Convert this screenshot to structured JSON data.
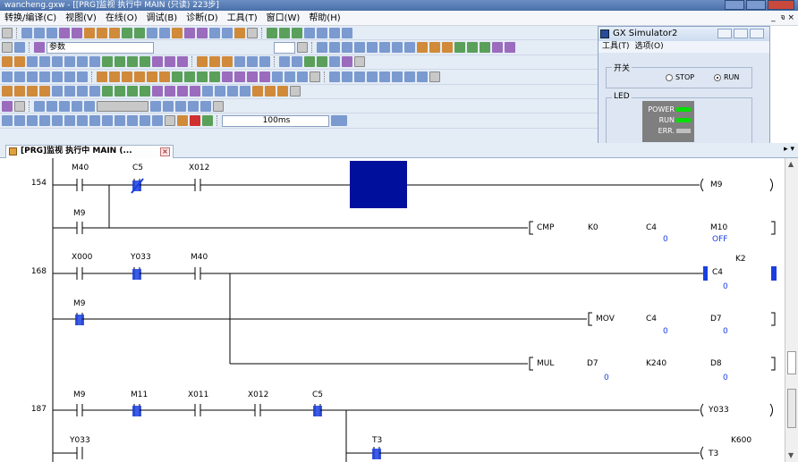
{
  "window": {
    "title": " wancheng.gxw - [[PRG]监视 执行中 MAIN (只读) 223步]",
    "mdi_controls": "_  จ ×"
  },
  "menu": {
    "items": [
      "转换/编译(C)",
      "视图(V)",
      "在线(O)",
      "调试(B)",
      "诊断(D)",
      "工具(T)",
      "窗口(W)",
      "帮助(H)"
    ]
  },
  "toolbar": {
    "param_label": "参数",
    "scan_time": "100ms"
  },
  "simulator": {
    "title": "GX Simulator2",
    "menu": [
      "工具(T)",
      "选项(O)"
    ],
    "switch_group": "开关",
    "stop_label": "STOP",
    "run_label": "RUN",
    "mode": "RUN",
    "led_group": "LED",
    "leds": [
      {
        "label": "POWER",
        "color": "#00e000"
      },
      {
        "label": "RUN",
        "color": "#00e000"
      },
      {
        "label": "ERR.",
        "color": "#c0c0c0"
      }
    ]
  },
  "tab": {
    "label": "[PRG]监视 执行中 MAIN (...",
    "close": "×",
    "nav": "▸ ▾"
  },
  "ladder": {
    "rungs": [
      {
        "step": "154",
        "contacts": [
          "M40",
          "C5",
          "X012"
        ],
        "coil": "M9"
      },
      {
        "contacts": [
          "M9"
        ],
        "instruction": "CMP",
        "operands": [
          "K0",
          "C4",
          "M10"
        ],
        "values": [
          "0",
          "OFF"
        ]
      },
      {
        "step": "168",
        "contacts": [
          "X000",
          "Y033",
          "M40"
        ],
        "coil": "C4",
        "coil_set": "K2",
        "coil_value": "0"
      },
      {
        "contacts": [
          "M9"
        ],
        "instruction": "MOV",
        "operands": [
          "C4",
          "D7"
        ],
        "values": [
          "0",
          "0"
        ]
      },
      {
        "instruction": "MUL",
        "operands": [
          "D7",
          "K240",
          "D8"
        ],
        "values": [
          "0",
          "0"
        ]
      },
      {
        "step": "187",
        "contacts": [
          "M9",
          "M11",
          "X011",
          "X012",
          "C5"
        ],
        "coil": "Y033"
      },
      {
        "contacts": [
          "Y033",
          "T3"
        ],
        "coil": "T3",
        "coil_set": "K600"
      }
    ]
  },
  "colors": {
    "active": "#1a3fe0",
    "cursor": "#00109c",
    "toolbar_bg": "#e4ecf6",
    "rail": "#000000"
  }
}
